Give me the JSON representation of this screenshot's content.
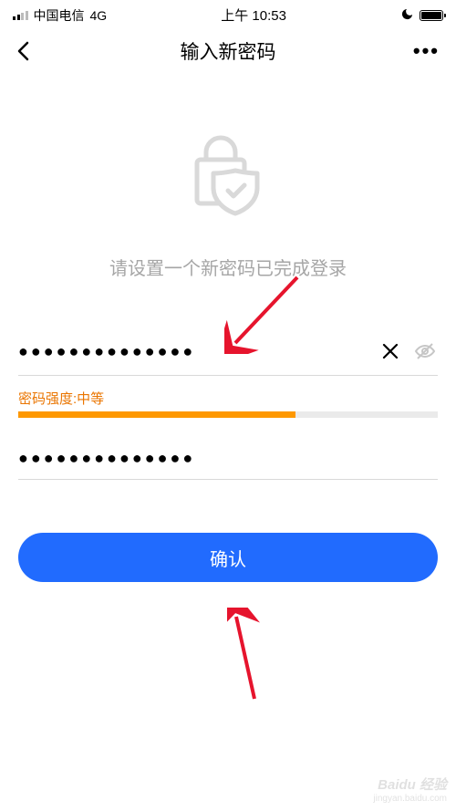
{
  "status": {
    "carrier": "中国电信",
    "network": "4G",
    "time": "上午 10:53"
  },
  "nav": {
    "title": "输入新密码"
  },
  "subtitle": "请设置一个新密码已完成登录",
  "fields": {
    "password1": "●●●●●●●●●●●●●●",
    "password2": "●●●●●●●●●●●●●●"
  },
  "strength": {
    "label": "密码强度:中等",
    "percent": 66,
    "color": "#fe9800"
  },
  "confirm_label": "确认",
  "watermark": {
    "main": "Baidu 经验",
    "sub": "jingyan.baidu.com"
  }
}
